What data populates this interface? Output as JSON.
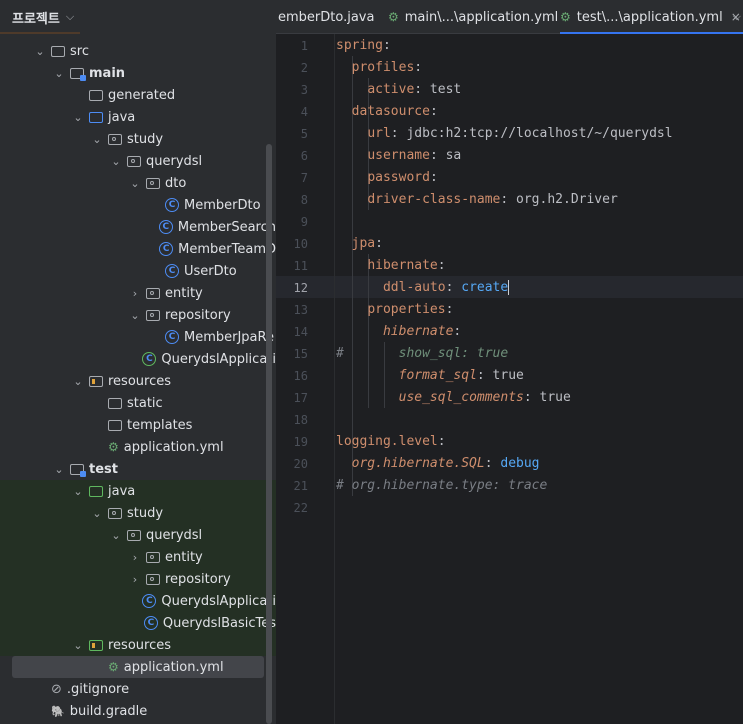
{
  "project_panel": {
    "title": "프로젝트",
    "tree": [
      {
        "label": "src",
        "level": 1,
        "icon": "folder",
        "expanded": true
      },
      {
        "label": "main",
        "level": 2,
        "icon": "module-folder",
        "expanded": true,
        "bold": true
      },
      {
        "label": "generated",
        "level": 3,
        "icon": "folder"
      },
      {
        "label": "java",
        "level": 3,
        "icon": "source-folder",
        "expanded": true
      },
      {
        "label": "study",
        "level": 4,
        "icon": "package",
        "expanded": true
      },
      {
        "label": "querydsl",
        "level": 5,
        "icon": "package",
        "expanded": true
      },
      {
        "label": "dto",
        "level": 6,
        "icon": "package",
        "expanded": true
      },
      {
        "label": "MemberDto",
        "level": 7,
        "icon": "class"
      },
      {
        "label": "MemberSearch",
        "level": 7,
        "icon": "class"
      },
      {
        "label": "MemberTeamD",
        "level": 7,
        "icon": "class"
      },
      {
        "label": "UserDto",
        "level": 7,
        "icon": "class"
      },
      {
        "label": "entity",
        "level": 6,
        "icon": "package",
        "expanded": false
      },
      {
        "label": "repository",
        "level": 6,
        "icon": "package",
        "expanded": true
      },
      {
        "label": "MemberJpaRe",
        "level": 7,
        "icon": "class"
      },
      {
        "label": "QuerydslApplicati",
        "level": 6,
        "icon": "spring-class"
      },
      {
        "label": "resources",
        "level": 3,
        "icon": "resources-folder",
        "expanded": true
      },
      {
        "label": "static",
        "level": 4,
        "icon": "folder"
      },
      {
        "label": "templates",
        "level": 4,
        "icon": "folder"
      },
      {
        "label": "application.yml",
        "level": 4,
        "icon": "yml"
      },
      {
        "label": "test",
        "level": 2,
        "icon": "module-folder",
        "expanded": true,
        "bold": true
      },
      {
        "label": "java",
        "level": 3,
        "icon": "test-source-folder",
        "expanded": true
      },
      {
        "label": "study",
        "level": 4,
        "icon": "package",
        "expanded": true
      },
      {
        "label": "querydsl",
        "level": 5,
        "icon": "package",
        "expanded": true
      },
      {
        "label": "entity",
        "level": 6,
        "icon": "package",
        "expanded": false
      },
      {
        "label": "repository",
        "level": 6,
        "icon": "package",
        "expanded": false
      },
      {
        "label": "QuerydslApplicati",
        "level": 6,
        "icon": "class"
      },
      {
        "label": "QuerydslBasicTes",
        "level": 6,
        "icon": "class"
      },
      {
        "label": "resources",
        "level": 3,
        "icon": "test-resources-folder",
        "expanded": true
      },
      {
        "label": "application.yml",
        "level": 4,
        "icon": "yml",
        "selected": true
      },
      {
        "label": ".gitignore",
        "level": 1,
        "icon": "ignore-file"
      },
      {
        "label": "build.gradle",
        "level": 1,
        "icon": "gradle-file"
      }
    ]
  },
  "tabs": [
    {
      "label": "emberDto.java",
      "active": false
    },
    {
      "label": "main\\...\\application.yml",
      "active": false
    },
    {
      "label": "test\\...\\application.yml",
      "active": true,
      "close": "×"
    }
  ],
  "editor": {
    "current_line": 12,
    "lines": [
      {
        "n": "1",
        "parts": [
          [
            "k",
            "spring"
          ],
          [
            "v",
            ":"
          ]
        ]
      },
      {
        "n": "2",
        "parts": [
          [
            "v",
            "  "
          ],
          [
            "k",
            "profiles"
          ],
          [
            "v",
            ":"
          ]
        ]
      },
      {
        "n": "3",
        "parts": [
          [
            "v",
            "    "
          ],
          [
            "k",
            "active"
          ],
          [
            "v",
            ": test"
          ]
        ]
      },
      {
        "n": "4",
        "parts": [
          [
            "v",
            "  "
          ],
          [
            "k",
            "datasource"
          ],
          [
            "v",
            ":"
          ]
        ]
      },
      {
        "n": "5",
        "parts": [
          [
            "v",
            "    "
          ],
          [
            "k",
            "url"
          ],
          [
            "v",
            ": jdbc:h2:tcp://localhost/~/querydsl"
          ]
        ]
      },
      {
        "n": "6",
        "parts": [
          [
            "v",
            "    "
          ],
          [
            "k",
            "username"
          ],
          [
            "v",
            ": sa"
          ]
        ]
      },
      {
        "n": "7",
        "parts": [
          [
            "v",
            "    "
          ],
          [
            "k",
            "password"
          ],
          [
            "v",
            ":"
          ]
        ]
      },
      {
        "n": "8",
        "parts": [
          [
            "v",
            "    "
          ],
          [
            "k",
            "driver-class-name"
          ],
          [
            "v",
            ": org.h2.Driver"
          ]
        ]
      },
      {
        "n": "9",
        "parts": []
      },
      {
        "n": "10",
        "parts": [
          [
            "v",
            "  "
          ],
          [
            "k",
            "jpa"
          ],
          [
            "v",
            ":"
          ]
        ]
      },
      {
        "n": "11",
        "parts": [
          [
            "v",
            "    "
          ],
          [
            "k",
            "hibernate"
          ],
          [
            "v",
            ":"
          ]
        ]
      },
      {
        "n": "12",
        "parts": [
          [
            "v",
            "      "
          ],
          [
            "k",
            "ddl-auto"
          ],
          [
            "v",
            ": "
          ],
          [
            "vb",
            "create"
          ]
        ]
      },
      {
        "n": "13",
        "parts": [
          [
            "v",
            "    "
          ],
          [
            "k",
            "properties"
          ],
          [
            "v",
            ":"
          ]
        ]
      },
      {
        "n": "14",
        "parts": [
          [
            "v",
            "      "
          ],
          [
            "ki",
            "hibernate"
          ],
          [
            "v",
            ":"
          ]
        ]
      },
      {
        "n": "15",
        "parts": [
          [
            "c",
            "#       "
          ],
          [
            "cv",
            "show_sql: true"
          ]
        ]
      },
      {
        "n": "16",
        "parts": [
          [
            "v",
            "        "
          ],
          [
            "ki",
            "format_sql"
          ],
          [
            "v",
            ": true"
          ]
        ]
      },
      {
        "n": "17",
        "parts": [
          [
            "v",
            "        "
          ],
          [
            "ki",
            "use_sql_comments"
          ],
          [
            "v",
            ": true"
          ]
        ]
      },
      {
        "n": "18",
        "parts": []
      },
      {
        "n": "19",
        "parts": [
          [
            "k",
            "logging.level"
          ],
          [
            "v",
            ":"
          ]
        ]
      },
      {
        "n": "20",
        "parts": [
          [
            "v",
            "  "
          ],
          [
            "ki",
            "org.hibernate.SQL"
          ],
          [
            "v",
            ": "
          ],
          [
            "vb",
            "debug"
          ]
        ]
      },
      {
        "n": "21",
        "parts": [
          [
            "c",
            "# org.hibernate.type: trace"
          ]
        ]
      },
      {
        "n": "22",
        "parts": []
      }
    ]
  }
}
